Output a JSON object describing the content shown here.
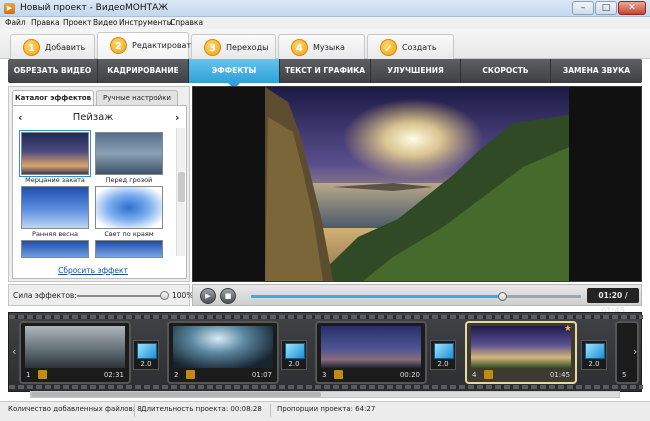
{
  "window": {
    "title": "Новый проект - ВидеоМОНТАЖ",
    "minimize": "–",
    "maximize": "□",
    "close": "✕"
  },
  "menu": [
    "Файл",
    "Правка",
    "Проект",
    "Видео",
    "Инструменты",
    "Справка"
  ],
  "steps": [
    {
      "num": "1",
      "label": "Добавить"
    },
    {
      "num": "2",
      "label": "Редактировать"
    },
    {
      "num": "3",
      "label": "Переходы"
    },
    {
      "num": "4",
      "label": "Музыка"
    },
    {
      "num": "✓",
      "label": "Создать"
    }
  ],
  "tabs": [
    "ОБРЕЗАТЬ ВИДЕО",
    "КАДРИРОВАНИЕ",
    "ЭФФЕКТЫ",
    "ТЕКСТ И ГРАФИКА",
    "УЛУЧШЕНИЯ",
    "СКОРОСТЬ",
    "ЗАМЕНА ЗВУКА"
  ],
  "active_tab": "ЭФФЕКТЫ",
  "effects_panel": {
    "subtabs": [
      "Каталог эффектов",
      "Ручные настройки"
    ],
    "category": "Пейзаж",
    "prev": "‹",
    "next": "›",
    "items": [
      "Мерцание заката",
      "Перед грозой",
      "Ранняя весна",
      "Свет по краям"
    ],
    "selected": "Мерцание заката",
    "reset": "Сбросить эффект"
  },
  "strength": {
    "label": "Сила эффектов:",
    "value": "100%",
    "level": 1.0
  },
  "player": {
    "play": "▶",
    "stop": "■",
    "time": "01:20 / 01:45",
    "progress": 0.76
  },
  "timeline": {
    "clips": [
      {
        "num": "1",
        "duration": "02:31"
      },
      {
        "num": "2",
        "duration": "01:07"
      },
      {
        "num": "3",
        "duration": "00:20"
      },
      {
        "num": "4",
        "duration": "01:45"
      },
      {
        "num": "5",
        "duration": ""
      }
    ],
    "selected_clip": "4",
    "transitions": [
      "2.0",
      "2.0",
      "2.0",
      "2.0"
    ],
    "left_arrow": "‹",
    "right_arrow": "›",
    "star": "★"
  },
  "status": {
    "files": "Количество добавленных файлов: 8",
    "duration": "Длительность проекта: 00:08:28",
    "proportions": "Пропорции проекта: 64:27"
  },
  "colors": {
    "accent": "#2ea1d9",
    "toolbar_dark": "#3e4044",
    "step_orange": "#f2a219"
  }
}
